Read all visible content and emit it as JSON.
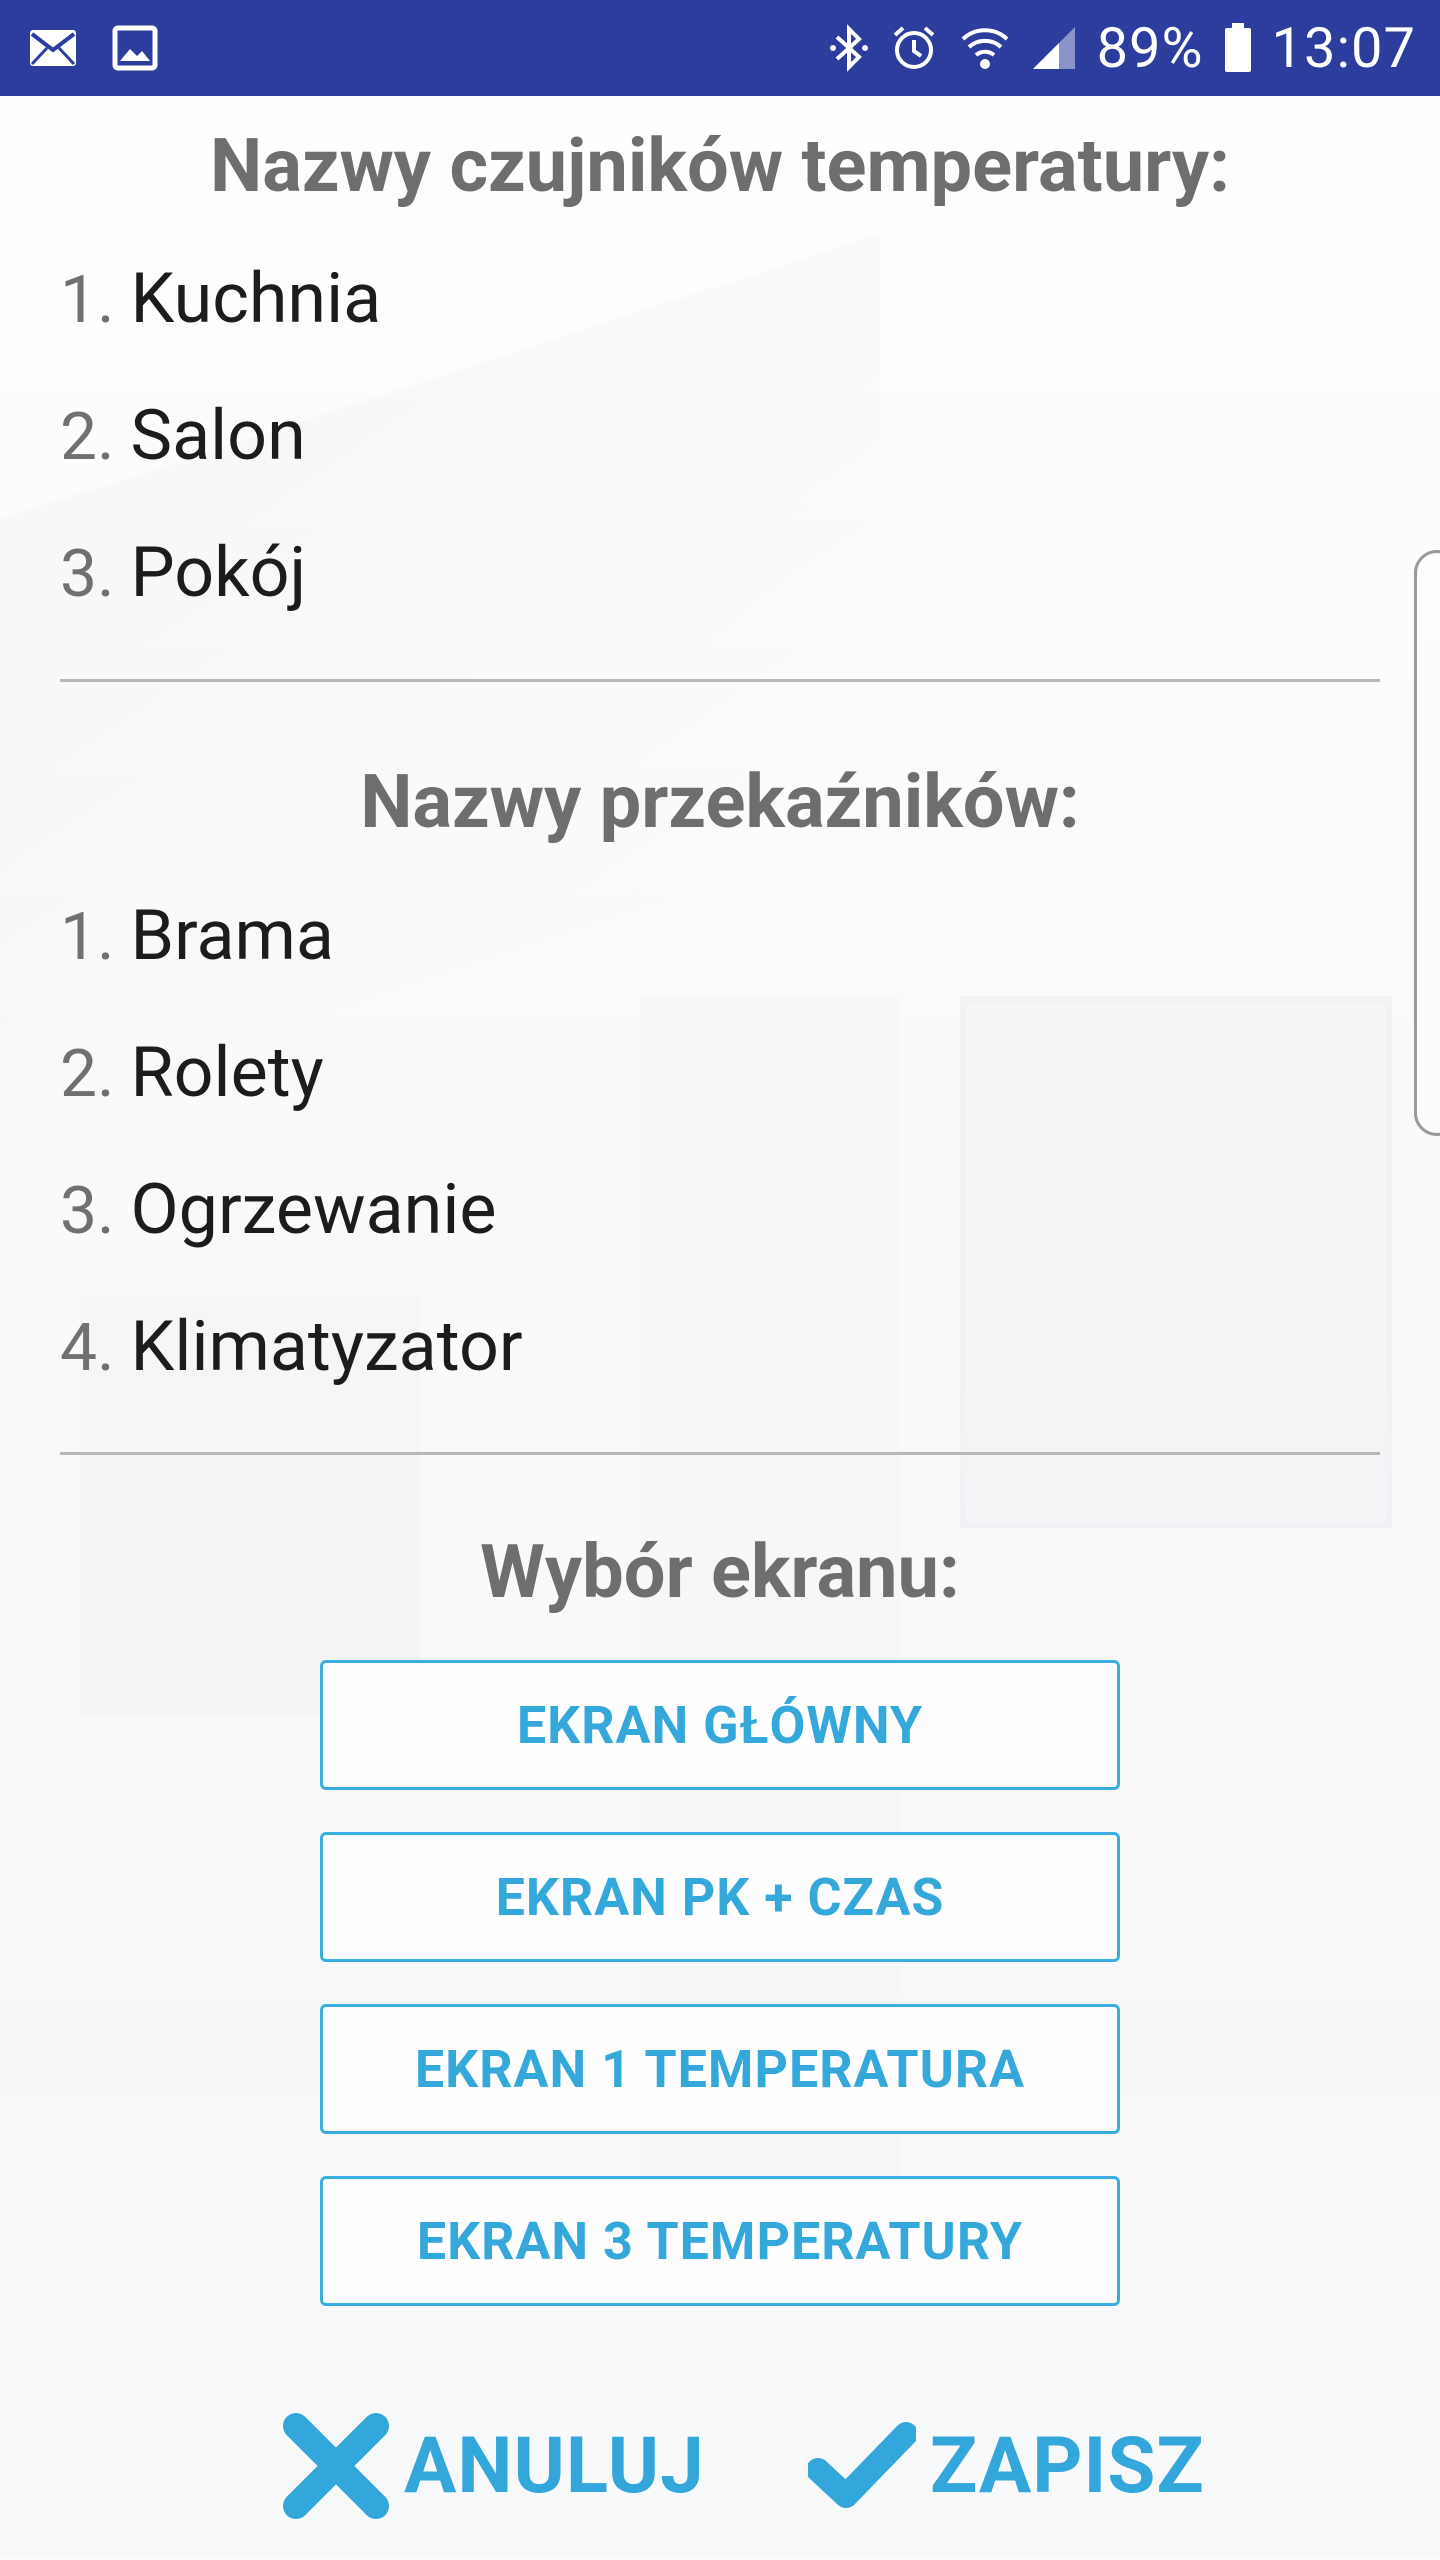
{
  "status_bar": {
    "battery": "89%",
    "time": "13:07",
    "icons": [
      "mail-icon",
      "image-icon",
      "bluetooth-icon",
      "alarm-icon",
      "wifi-icon",
      "signal-icon",
      "battery-icon"
    ]
  },
  "temperature_sensors": {
    "title": "Nazwy czujników temperatury:",
    "items": [
      {
        "num": "1.",
        "name": "Kuchnia"
      },
      {
        "num": "2.",
        "name": "Salon"
      },
      {
        "num": "3.",
        "name": "Pokój"
      }
    ]
  },
  "relays": {
    "title": "Nazwy przekaźników:",
    "items": [
      {
        "num": "1.",
        "name": "Brama"
      },
      {
        "num": "2.",
        "name": "Rolety"
      },
      {
        "num": "3.",
        "name": "Ogrzewanie"
      },
      {
        "num": "4.",
        "name": "Klimatyzator"
      }
    ]
  },
  "screen_select": {
    "title": "Wybór ekranu:",
    "buttons": [
      "EKRAN GŁÓWNY",
      "EKRAN PK + CZAS",
      "EKRAN 1 TEMPERATURA",
      "EKRAN 3 TEMPERATURY"
    ]
  },
  "actions": {
    "cancel_label": "ANULUJ",
    "save_label": "ZAPISZ"
  },
  "colors": {
    "status_bar": "#2d3d9e",
    "accent": "#34a7db"
  }
}
